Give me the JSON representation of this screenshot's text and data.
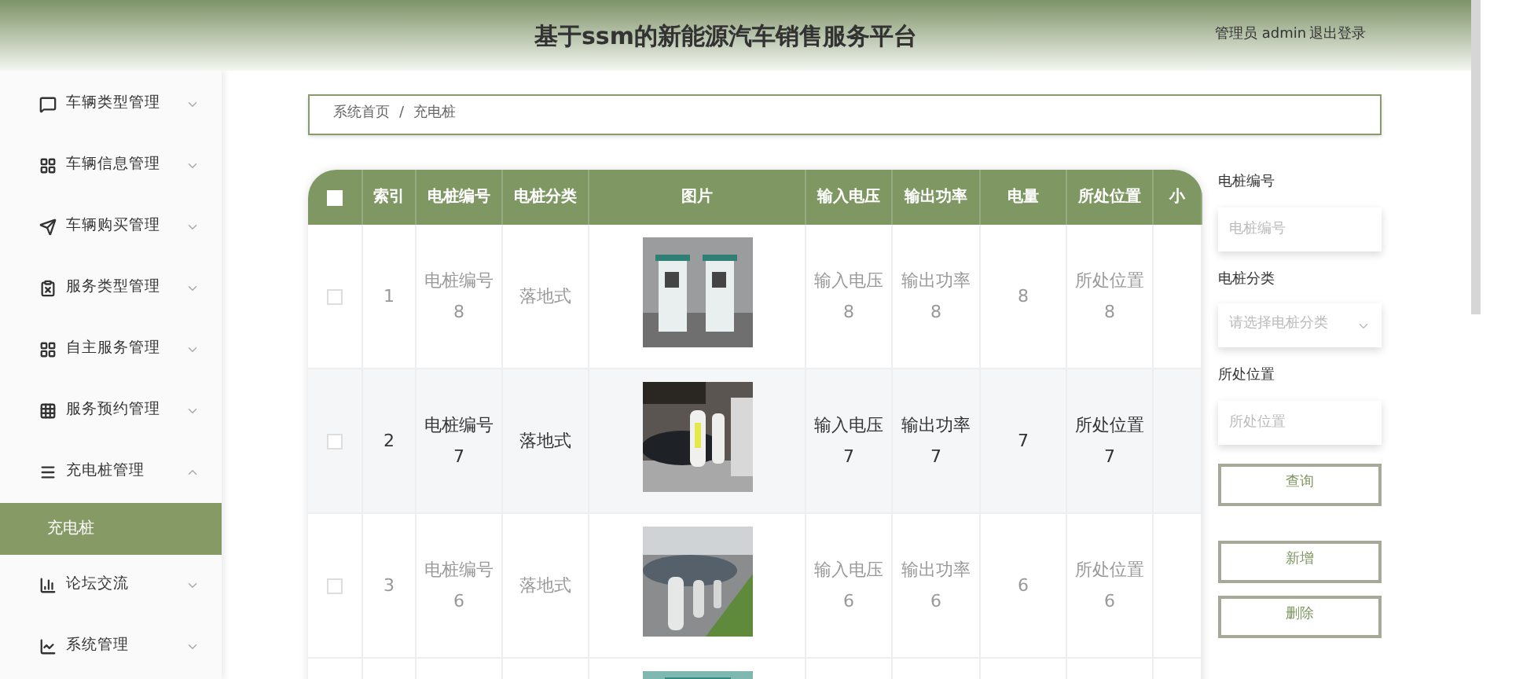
{
  "header": {
    "title": "基于ssm的新能源汽车销售服务平台",
    "user": "管理员 admin",
    "logout": "退出登录"
  },
  "sidebar": {
    "items": [
      {
        "label": "车辆类型管理",
        "expanded": false
      },
      {
        "label": "车辆信息管理",
        "expanded": false
      },
      {
        "label": "车辆购买管理",
        "expanded": false
      },
      {
        "label": "服务类型管理",
        "expanded": false
      },
      {
        "label": "自主服务管理",
        "expanded": false
      },
      {
        "label": "服务预约管理",
        "expanded": false
      },
      {
        "label": "充电桩管理",
        "expanded": true,
        "children": [
          {
            "label": "充电桩",
            "selected": true
          }
        ]
      },
      {
        "label": "论坛交流",
        "expanded": false
      },
      {
        "label": "系统管理",
        "expanded": false
      }
    ]
  },
  "breadcrumb": [
    "系统首页",
    "/",
    "充电桩"
  ],
  "table": {
    "all_checked": false,
    "columns": [
      "索引",
      "电桩编号",
      "电桩分类",
      "图片",
      "输入电压",
      "输出功率",
      "电量",
      "所处位置",
      "小"
    ],
    "rows": [
      {
        "checked": false,
        "highlighted": false,
        "index": "1",
        "code": [
          "电桩编号",
          "8"
        ],
        "category": "落地式",
        "image": {
          "kind": "picture"
        },
        "input": [
          "输入电压",
          "8"
        ],
        "output": [
          "输出功率",
          "8"
        ],
        "charge": "8",
        "location": [
          "所处位置",
          "8"
        ]
      },
      {
        "checked": false,
        "highlighted": true,
        "index": "2",
        "code": [
          "电桩编号",
          "7"
        ],
        "category": "落地式",
        "image": {
          "kind": "picture"
        },
        "input": [
          "输入电压",
          "7"
        ],
        "output": [
          "输出功率",
          "7"
        ],
        "charge": "7",
        "location": [
          "所处位置",
          "7"
        ]
      },
      {
        "checked": false,
        "highlighted": false,
        "index": "3",
        "code": [
          "电桩编号",
          "6"
        ],
        "category": "落地式",
        "image": {
          "kind": "picture"
        },
        "input": [
          "输入电压",
          "6"
        ],
        "output": [
          "输出功率",
          "6"
        ],
        "charge": "6",
        "location": [
          "所处位置",
          "6"
        ]
      },
      {
        "image": {
          "kind": "picture"
        }
      }
    ]
  },
  "filters": [
    {
      "kind": "input",
      "label": "电桩编号",
      "placeholder": "电桩编号"
    },
    {
      "kind": "select",
      "label": "电桩分类",
      "placeholder": "请选择电桩分类"
    },
    {
      "kind": "input",
      "label": "所处位置",
      "placeholder": "所处位置"
    }
  ],
  "buttons": [
    "查询",
    "新增",
    "删除"
  ]
}
